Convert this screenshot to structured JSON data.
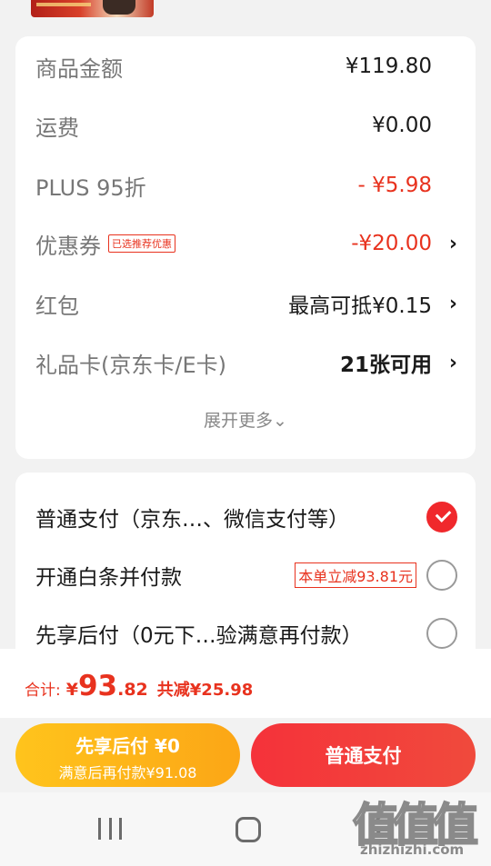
{
  "amounts": {
    "rows": [
      {
        "label": "商品金额",
        "value": "¥119.80"
      },
      {
        "label": "运费",
        "value": "¥0.00"
      },
      {
        "label": "PLUS 95折",
        "value": "- ¥5.98"
      },
      {
        "label": "优惠券",
        "tag": "已选推荐优惠",
        "value": "-¥20.00",
        "chevron": "›"
      },
      {
        "label": "红包",
        "value": "最高可抵¥0.15",
        "chevron": "›"
      },
      {
        "label": "礼品卡(京东卡/E卡)",
        "value": "21张可用",
        "chevron": "›"
      }
    ],
    "expand_label": "展开更多⌄"
  },
  "payment": {
    "options": [
      {
        "label": "普通支付（京东…、微信支付等）",
        "selected": true
      },
      {
        "label": "开通白条并付款",
        "promo": "本单立减93.81元",
        "selected": false
      },
      {
        "label": "先享后付（0元下…验满意再付款）",
        "selected": false
      }
    ]
  },
  "summary": {
    "total_label": "合计:",
    "currency": "¥",
    "total_int": "93",
    "total_dec": ".82",
    "saved": "共减¥25.98"
  },
  "buttons": {
    "pay_later_title": "先享后付 ¥0",
    "pay_later_sub": "满意后再付款¥91.08",
    "pay_normal": "普通支付"
  },
  "watermark": {
    "chars": "值值值",
    "url": "zhizhizhi.com"
  },
  "colors": {
    "accent_red": "#e8321e",
    "button_red": "#f5323a",
    "button_yellow": "#fcb41a",
    "background": "#f2f2f2"
  },
  "icons": {
    "chevron": "chevron-right-icon",
    "selected": "check-circle-icon",
    "unselected": "radio-empty-icon",
    "nav": [
      "recents-icon",
      "home-icon",
      "back-icon"
    ]
  }
}
